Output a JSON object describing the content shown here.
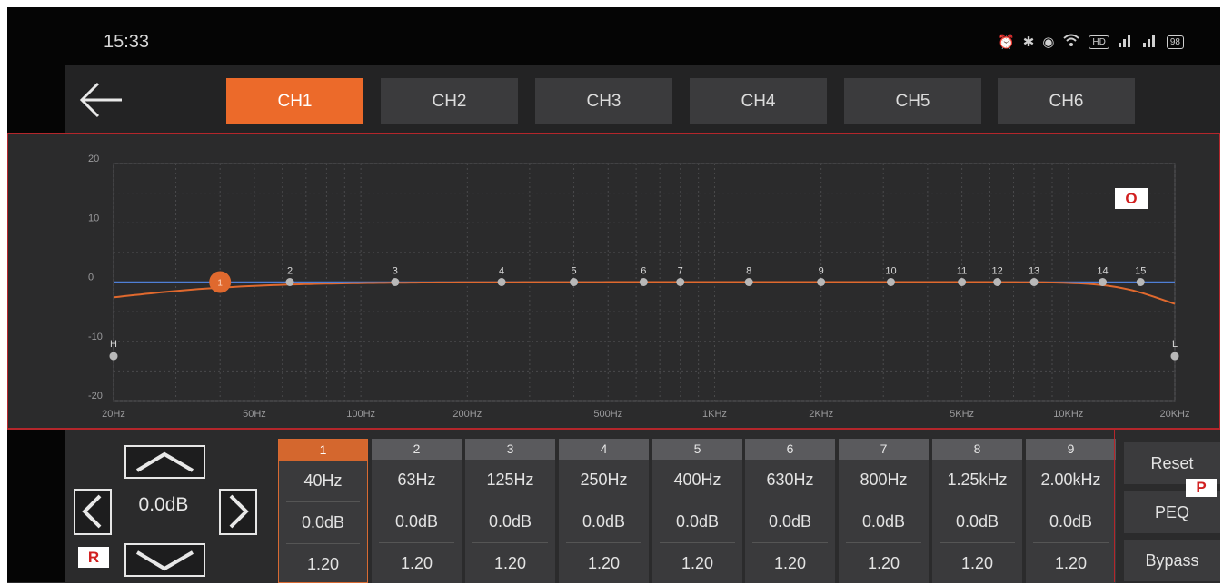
{
  "status_bar": {
    "time": "15:33",
    "icons": [
      "alarm-icon",
      "bluetooth-icon",
      "location-icon",
      "wifi-icon",
      "hd-icon",
      "signal-icon",
      "signal-icon",
      "battery-icon"
    ],
    "hd_label": "HD",
    "battery": "98"
  },
  "nav": {
    "back_icon": "arrow-left-icon",
    "tabs": [
      {
        "label": "CH1",
        "active": true
      },
      {
        "label": "CH2",
        "active": false
      },
      {
        "label": "CH3",
        "active": false
      },
      {
        "label": "CH4",
        "active": false
      },
      {
        "label": "CH5",
        "active": false
      },
      {
        "label": "CH6",
        "active": false
      }
    ]
  },
  "graph": {
    "y_ticks": [
      "20",
      "10",
      "0",
      "-10",
      "-20"
    ],
    "x_ticks": [
      {
        "label": "20Hz",
        "hz": 20
      },
      {
        "label": "50Hz",
        "hz": 50
      },
      {
        "label": "100Hz",
        "hz": 100
      },
      {
        "label": "200Hz",
        "hz": 200
      },
      {
        "label": "500Hz",
        "hz": 500
      },
      {
        "label": "1KHz",
        "hz": 1000
      },
      {
        "label": "2KHz",
        "hz": 2000
      },
      {
        "label": "5KHz",
        "hz": 5000
      },
      {
        "label": "10KHz",
        "hz": 10000
      },
      {
        "label": "20KHz",
        "hz": 20000
      }
    ],
    "ylim": [
      -20,
      20
    ],
    "xlim_hz": [
      20,
      20000
    ],
    "bands": [
      {
        "label": "1",
        "hz": 40,
        "gain": 0
      },
      {
        "label": "2",
        "hz": 63,
        "gain": 0
      },
      {
        "label": "3",
        "hz": 125,
        "gain": 0
      },
      {
        "label": "4",
        "hz": 250,
        "gain": 0
      },
      {
        "label": "5",
        "hz": 400,
        "gain": 0
      },
      {
        "label": "6",
        "hz": 630,
        "gain": 0
      },
      {
        "label": "7",
        "hz": 800,
        "gain": 0
      },
      {
        "label": "8",
        "hz": 1250,
        "gain": 0
      },
      {
        "label": "9",
        "hz": 2000,
        "gain": 0
      },
      {
        "label": "10",
        "hz": 3150,
        "gain": 0
      },
      {
        "label": "11",
        "hz": 5000,
        "gain": 0
      },
      {
        "label": "12",
        "hz": 6300,
        "gain": 0
      },
      {
        "label": "13",
        "hz": 8000,
        "gain": 0
      },
      {
        "label": "14",
        "hz": 12500,
        "gain": 0
      },
      {
        "label": "15",
        "hz": 16000,
        "gain": 0
      }
    ],
    "selected_band": "1",
    "highpass": {
      "label": "H",
      "hz": 20,
      "gain": -12.5
    },
    "lowpass": {
      "label": "L",
      "hz": 20000,
      "gain": -12.5
    },
    "marker": "O",
    "colors": {
      "curve": "#e0692e",
      "selected": "#e0692e",
      "point": "#b8b8b8",
      "flat": "#4f7fd6"
    }
  },
  "controls": {
    "gain": "0.0dB",
    "up_icon": "chevron-up-icon",
    "down_icon": "chevron-down-icon",
    "left_icon": "chevron-left-icon",
    "right_icon": "chevron-right-icon",
    "marker": "R"
  },
  "band_table": [
    {
      "num": "1",
      "freq": "40Hz",
      "gain": "0.0dB",
      "q": "1.20",
      "active": true
    },
    {
      "num": "2",
      "freq": "63Hz",
      "gain": "0.0dB",
      "q": "1.20",
      "active": false
    },
    {
      "num": "3",
      "freq": "125Hz",
      "gain": "0.0dB",
      "q": "1.20",
      "active": false
    },
    {
      "num": "4",
      "freq": "250Hz",
      "gain": "0.0dB",
      "q": "1.20",
      "active": false
    },
    {
      "num": "5",
      "freq": "400Hz",
      "gain": "0.0dB",
      "q": "1.20",
      "active": false
    },
    {
      "num": "6",
      "freq": "630Hz",
      "gain": "0.0dB",
      "q": "1.20",
      "active": false
    },
    {
      "num": "7",
      "freq": "800Hz",
      "gain": "0.0dB",
      "q": "1.20",
      "active": false
    },
    {
      "num": "8",
      "freq": "1.25kHz",
      "gain": "0.0dB",
      "q": "1.20",
      "active": false
    },
    {
      "num": "9",
      "freq": "2.00kHz",
      "gain": "0.0dB",
      "q": "1.20",
      "active": false
    }
  ],
  "side_buttons": {
    "reset": "Reset",
    "peq": "PEQ",
    "bypass": "Bypass",
    "marker": "P"
  }
}
